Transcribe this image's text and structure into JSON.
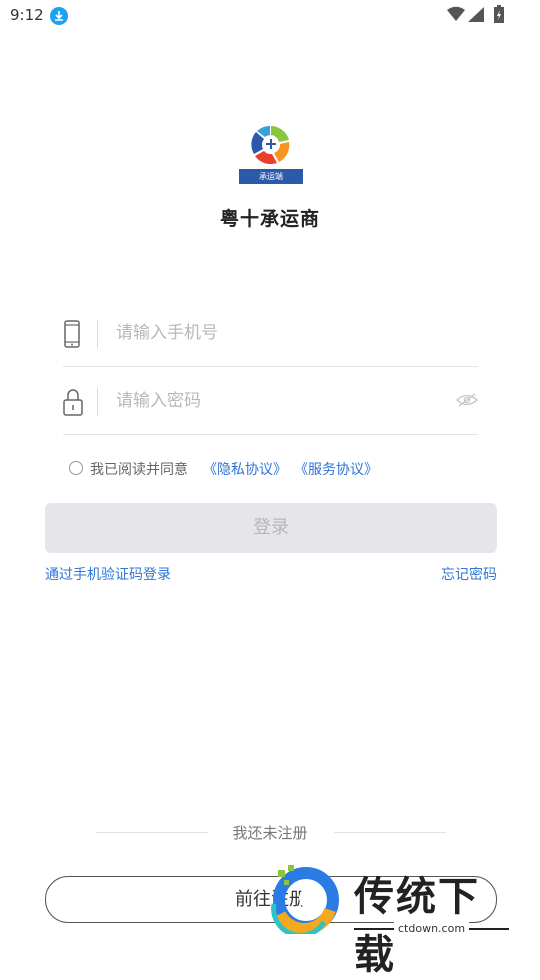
{
  "status_bar": {
    "time": "9:12"
  },
  "app": {
    "logo_banner": "承运端",
    "name": "粤十承运商"
  },
  "form": {
    "phone_placeholder": "请输入手机号",
    "password_placeholder": "请输入密码"
  },
  "agreement": {
    "text": "我已阅读并同意",
    "privacy_link": "《隐私协议》",
    "service_link": "《服务协议》"
  },
  "buttons": {
    "login": "登录",
    "sms_login": "通过手机验证码登录",
    "forgot_password": "忘记密码",
    "register_prompt": "我还未注册",
    "register": "前往注册"
  },
  "watermark": {
    "title": "传统下载",
    "url": "ctdown.com"
  },
  "colors": {
    "link": "#2f76d8",
    "login_button_bg": "#e6e6ea",
    "logo_banner_bg": "#2d5aa8"
  }
}
